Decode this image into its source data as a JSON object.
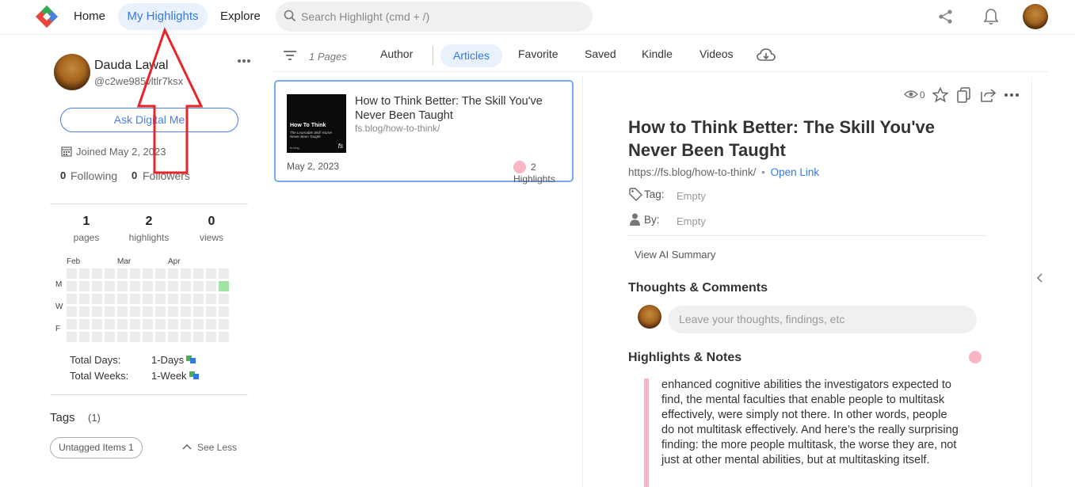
{
  "nav": {
    "home": "Home",
    "my_highlights": "My Highlights",
    "explore": "Explore",
    "search_placeholder": "Search Highlight (cmd + /)"
  },
  "profile": {
    "name": "Dauda Lawal",
    "handle": "@c2we985vltlr7ksx",
    "ask_button": "Ask Digital Me",
    "joined": "Joined May 2, 2023",
    "following_count": "0",
    "following_label": "Following",
    "followers_count": "0",
    "followers_label": "Followers"
  },
  "stats": [
    {
      "value": "1",
      "label": "pages"
    },
    {
      "value": "2",
      "label": "highlights"
    },
    {
      "value": "0",
      "label": "views"
    }
  ],
  "activity": {
    "months": [
      "Feb",
      "Mar",
      "Apr"
    ],
    "days": [
      "M",
      "W",
      "F"
    ],
    "total_days_label": "Total Days:",
    "total_days_value": "1-Days",
    "total_weeks_label": "Total Weeks:",
    "total_weeks_value": "1-Week"
  },
  "tags": {
    "title": "Tags",
    "count": "(1)",
    "untagged": "Untagged Items 1",
    "see_less": "See Less"
  },
  "filter_bar": {
    "pages": "1 Pages",
    "tabs": [
      "Author",
      "Articles",
      "Favorite",
      "Saved",
      "Kindle",
      "Videos"
    ],
    "active_tab": "Articles"
  },
  "card": {
    "thumb_title": "How To Think",
    "thumb_sub": "The Learnable Skill You've Never Been Taught",
    "thumb_brand": "fs",
    "thumb_source": "fs.blog",
    "title": "How to Think Better: The Skill You've Never Been Taught",
    "url": "fs.blog/how-to-think/",
    "date": "May 2, 2023",
    "highlights": "2 Highlights"
  },
  "article": {
    "views": "0",
    "title": "How to Think Better: The Skill You've Never Been Taught",
    "url": "https://fs.blog/how-to-think/",
    "separator": "•",
    "open_link": "Open Link",
    "tag_label": "Tag:",
    "tag_value": "Empty",
    "by_label": "By:",
    "by_value": "Empty",
    "ai_summary": "View AI Summary",
    "thoughts_title": "Thoughts & Comments",
    "comment_placeholder": "Leave your thoughts, findings, etc",
    "highlights_title": "Highlights & Notes",
    "quote": "enhanced cognitive abilities the investigators expected to find, the mental faculties that enable people to multitask effectively, were simply not there. In other words, people do not multitask effectively. And here’s the really surprising finding: the more people multitask, the worse they are, not just at other mental abilities, but at multitasking itself."
  },
  "colors": {
    "accent": "#3478e0",
    "active_bg": "#e9f1fd",
    "highlight_pink": "#f7b6c4",
    "annotation_red": "#e8232a"
  }
}
